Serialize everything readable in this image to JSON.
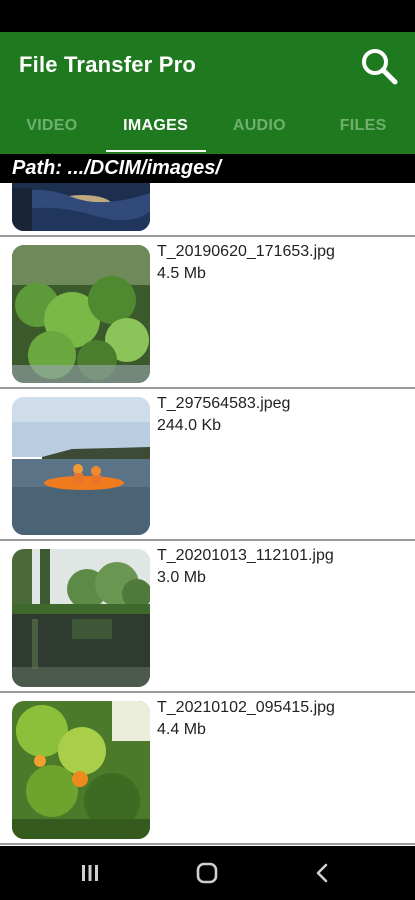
{
  "app": {
    "title": "File Transfer Pro"
  },
  "tabs": [
    {
      "label": "VIDEO",
      "active": false
    },
    {
      "label": "IMAGES",
      "active": true
    },
    {
      "label": "AUDIO",
      "active": false
    },
    {
      "label": "FILES",
      "active": false
    }
  ],
  "path": "Path: .../DCIM/images/",
  "files": [
    {
      "name": "T_20190620_171653.jpg",
      "size": "4.5 Mb",
      "thumb": "plants-thumbnail"
    },
    {
      "name": "T_297564583.jpeg",
      "size": "244.0 Kb",
      "thumb": "kayak-thumbnail"
    },
    {
      "name": "T_20201013_112101.jpg",
      "size": "3.0 Mb",
      "thumb": "pond-thumbnail"
    },
    {
      "name": "T_20210102_095415.jpg",
      "size": "4.4 Mb",
      "thumb": "orange-tree-thumbnail"
    }
  ],
  "icons": [
    "search-icon",
    "recents-icon",
    "home-icon",
    "back-icon"
  ],
  "colors": {
    "appbar": "#1f7a1f",
    "tab_inactive": "#6fb06f",
    "tab_active": "#ffffff"
  }
}
